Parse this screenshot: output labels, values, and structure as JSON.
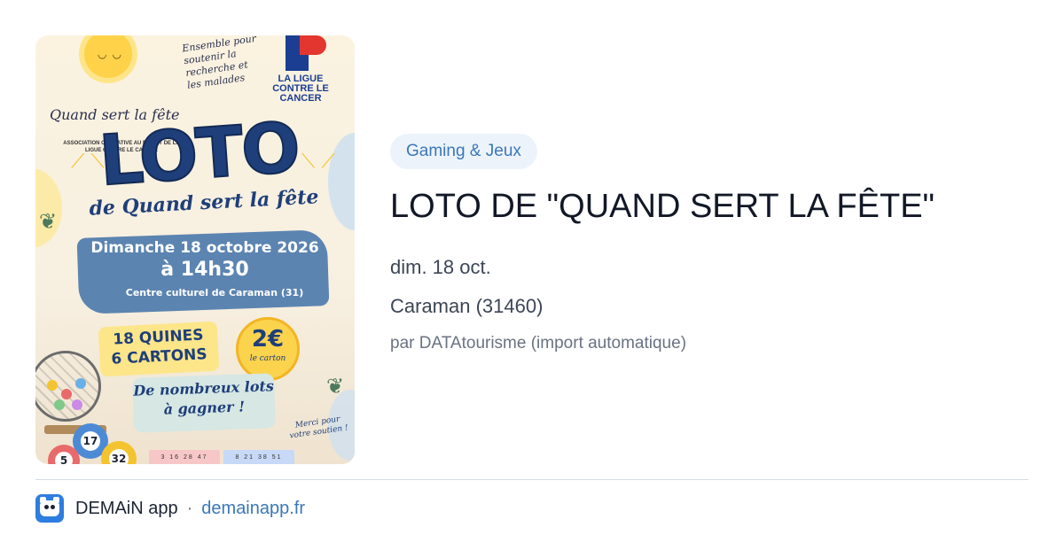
{
  "poster": {
    "association_name": "Quand sert la fête",
    "association_subtitle": "ASSOCIATION CARITATIVE AU PROFIT DE LA LIGUE CONTRE LE CANCER",
    "support_note": "Ensemble pour soutenir la recherche et les malades",
    "partner_name": "LA LIGUE CONTRE LE CANCER",
    "headline": "LOTO",
    "headline_sub": "de Quand sert la fête",
    "date_line": "Dimanche 18 octobre 2026",
    "time_line": "à 14h30",
    "venue_line": "Centre culturel de Caraman (31)",
    "quines_line1": "18 QUINES",
    "quines_line2": "6 CARTONS",
    "price": "2€",
    "price_unit": "le carton",
    "lots_line1": "De nombreux lots",
    "lots_line2": "à gagner !",
    "thanks": "Merci pour votre soutien !",
    "ball_numbers": [
      "17",
      "5",
      "32"
    ],
    "card_numbers": [
      "3 16 28 47",
      "8 21 38 51"
    ]
  },
  "event": {
    "category": "Gaming & Jeux",
    "title": "LOTO DE \"QUAND SERT LA FÊTE\"",
    "date": "dim. 18 oct.",
    "location": "Caraman (31460)",
    "author": "par DATAtourisme (import automatique)"
  },
  "footer": {
    "app_name": "DEMAiN app",
    "separator": "·",
    "domain": "demainapp.fr"
  },
  "colors": {
    "tag_bg": "#edf3fb",
    "tag_text": "#3a78b8",
    "link": "#3a78b8",
    "app_icon": "#2e7de0",
    "poster_blue": "#1f3f7a"
  }
}
